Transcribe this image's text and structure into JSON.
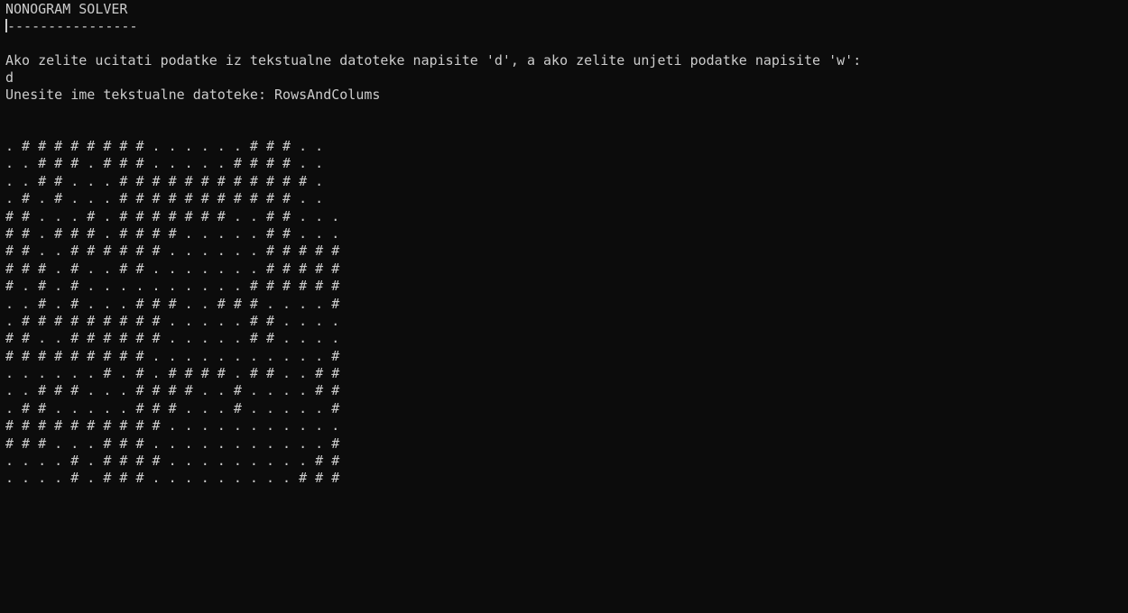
{
  "console": {
    "title": "NONOGRAM SOLVER",
    "underline": "----------------",
    "prompt": "Ako zelite ucitati podatke iz tekstualne datoteke napisite 'd', a ako zelite unjeti podatke napisite 'w':",
    "answer": "d",
    "file_prompt": "Unesite ime tekstualne datoteke: RowsAndColums",
    "grid": [
      ". # # # # # # # # . . . . . . # # # . .",
      ". . # # # . # # # . . . . . # # # # . .",
      ". . # # . . . # # # # # # # # # # # # .",
      ". # . # . . . # # # # # # # # # # # . .",
      "# # . . . # . # # # # # # # . . # # . . .",
      "# # . # # # . # # # # . . . . . # # . . .",
      "# # . . # # # # # # . . . . . . # # # # #",
      "# # # . # . . # # . . . . . . . # # # # #",
      "# . # . # . . . . . . . . . . # # # # # #",
      ". . # . # . . . # # # . . # # # . . . . #",
      ". # # # # # # # # # . . . . . # # . . . .",
      "# # . . # # # # # # . . . . . # # . . . .",
      "# # # # # # # # # . . . . . . . . . . . #",
      ". . . . . . # . # . # # # # . # # . . # #",
      ". . # # # . . . # # # # . . # . . . . # #",
      ". # # . . . . . # # # . . . # . . . . . #",
      "# # # # # # # # # # . . . . . . . . . . .",
      "# # # . . . # # # . . . . . . . . . . . #",
      ". . . . # . # # # # . . . . . . . . . # #",
      ". . . . # . # # # . . . . . . . . . # # #"
    ]
  }
}
